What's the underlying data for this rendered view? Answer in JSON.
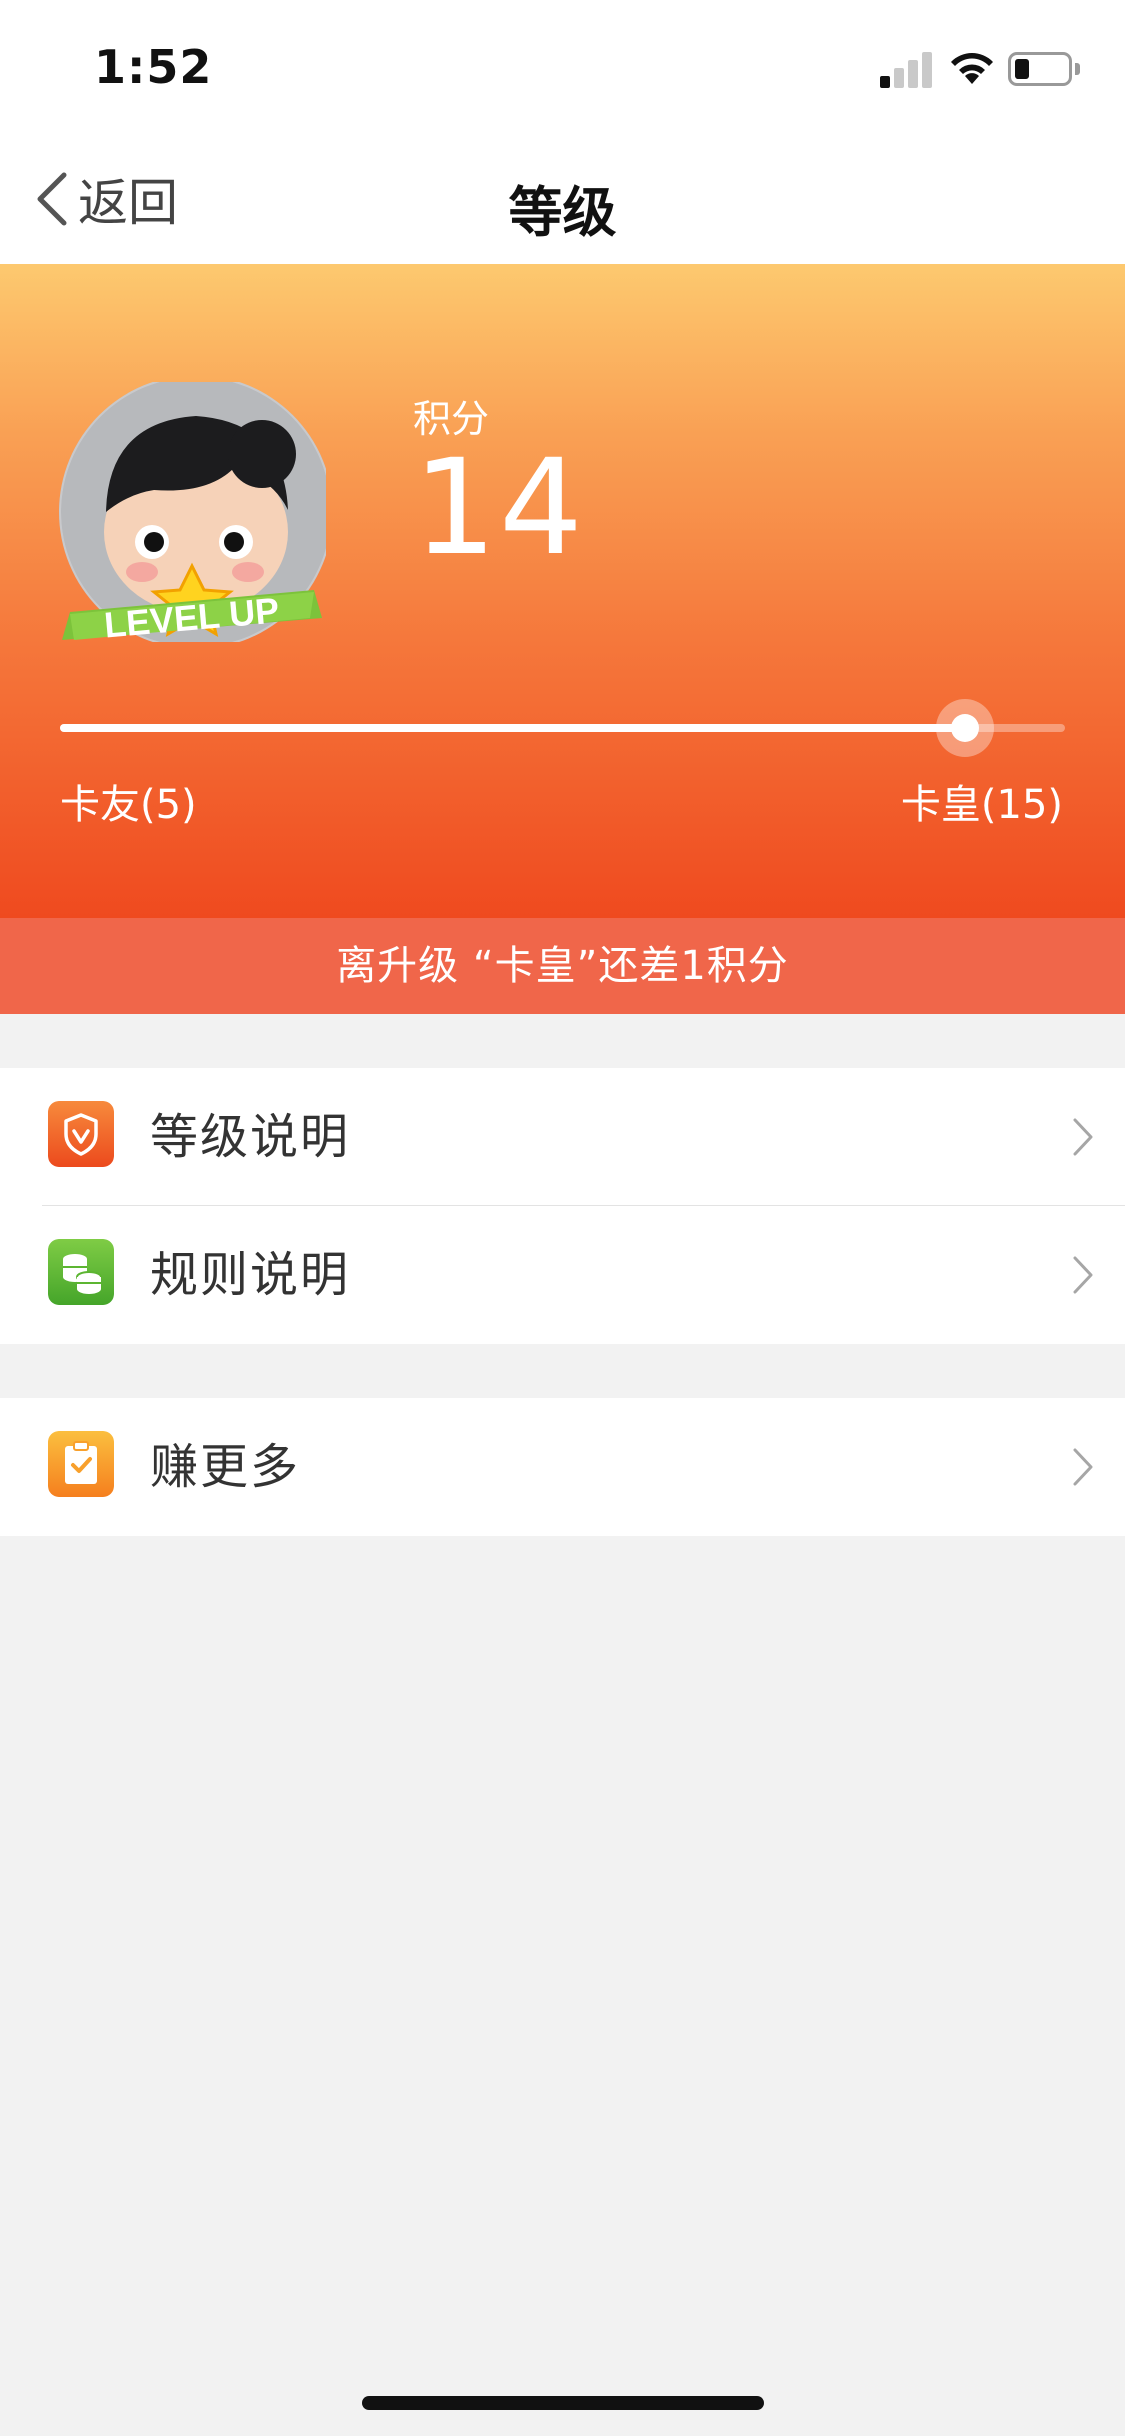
{
  "status_bar": {
    "time": "1:52"
  },
  "nav": {
    "back_label": "返回",
    "title": "等级"
  },
  "header": {
    "score_label": "积分",
    "score_value": "14",
    "current_level": "卡友(5)",
    "next_level": "卡皇(15)",
    "progress_fraction": 0.9,
    "avatar_badge_text": "LEVEL UP"
  },
  "notice": {
    "text": "离升级 “卡皇”还差1积分"
  },
  "menu": {
    "items": [
      {
        "label": "等级说明",
        "icon": "shield-icon",
        "color": "#f26a2a"
      },
      {
        "label": "规则说明",
        "icon": "coins-icon",
        "color": "#5cb531"
      },
      {
        "label": "赚更多",
        "icon": "clipboard-check-icon",
        "color": "#f8a02c"
      }
    ]
  },
  "colors": {
    "header_gradient": [
      "#fdc96f",
      "#f9a054",
      "#f5773b",
      "#ef4a1f"
    ],
    "notice_bar": "#f0664a",
    "background": "#f2f2f2"
  }
}
